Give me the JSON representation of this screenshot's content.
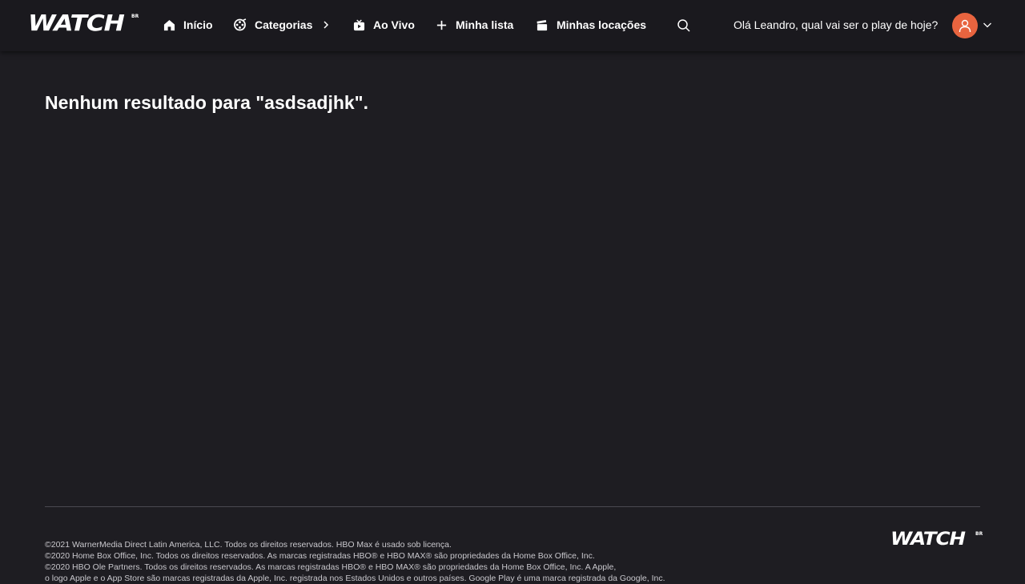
{
  "header": {
    "logo_text": "WATCH",
    "logo_sup": "BR",
    "nav": [
      {
        "label": "Início",
        "icon": "home-icon"
      },
      {
        "label": "Categorias",
        "icon": "film-reel-icon"
      },
      {
        "label": "Ao Vivo",
        "icon": "live-tv-icon"
      },
      {
        "label": "Minha lista",
        "icon": "plus-icon"
      },
      {
        "label": "Minhas locações",
        "icon": "clapperboard-icon"
      }
    ],
    "search_icon": "search-icon",
    "greeting": "Olá Leandro, qual vai ser o play de hoje?",
    "avatar_color": "#e8643f"
  },
  "main": {
    "title": "Nenhum resultado para \"asdsadjhk\"."
  },
  "footer": {
    "lines": [
      "©2021 WarnerMedia Direct Latin America, LLC. Todos os direitos reservados. HBO Max é usado sob licença.",
      "©2020 Home Box Office, Inc. Todos os direitos reservados. As marcas registradas HBO® e HBO MAX® são propriedades da Home Box Office, Inc.",
      "©2020 HBO Ole Partners. Todos os direitos reservados. As marcas registradas HBO® e HBO MAX® são propriedades da Home Box Office, Inc. A Apple,",
      "o logo Apple e o App Store são marcas registradas da Apple, Inc. registrada nos Estados Unidos e outros países. Google Play é uma marca registrada da Google, Inc."
    ],
    "logo_text": "WATCH",
    "logo_sup": "BR"
  },
  "colors": {
    "background": "#1e1d22",
    "topbar": "#1a191e",
    "accent": "#e8643f"
  }
}
